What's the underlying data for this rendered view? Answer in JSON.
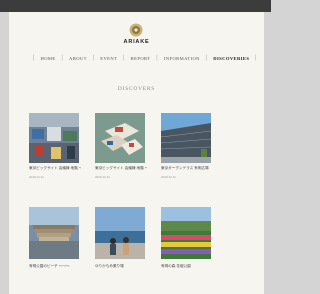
{
  "site": {
    "logo_text": "ARIAKE"
  },
  "nav": {
    "items": [
      {
        "label": "HOME",
        "active": false
      },
      {
        "label": "ABOUT",
        "active": false
      },
      {
        "label": "EVENT",
        "active": false
      },
      {
        "label": "REPORT",
        "active": false
      },
      {
        "label": "INFORMATION",
        "active": false
      },
      {
        "label": "DISCOVERIES",
        "active": true
      }
    ]
  },
  "section": {
    "title": "DISCOVERS"
  },
  "cards": [
    {
      "caption": "東京ビッグサイト 会議棟 地階 〜1/26〜 展示会",
      "date": "2019.12.11"
    },
    {
      "caption": "東京ビッグサイト 会議棟 地階 〜1/26〜 展示",
      "date": "2019.12.11"
    },
    {
      "caption": "東京ガーデンテラス 有明広場",
      "date": "2019.12.11"
    },
    {
      "caption": "有明公園のビーチ 〜〜〜",
      "date": ""
    },
    {
      "caption": "ゆりかもめ乗り場",
      "date": ""
    },
    {
      "caption": "有明の森 花壇公園",
      "date": ""
    }
  ]
}
